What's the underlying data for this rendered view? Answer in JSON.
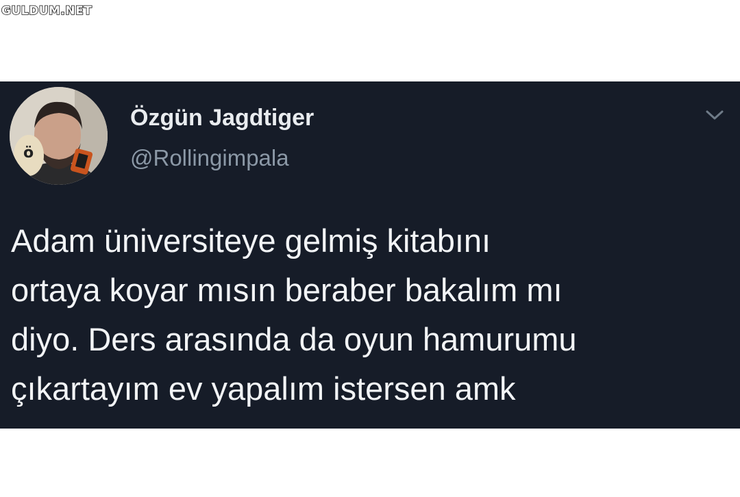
{
  "watermark": {
    "text": "GULDUM.NET"
  },
  "tweet": {
    "author": {
      "name": "Özgün Jagdtiger",
      "handle": "@Rollingimpala",
      "avatar_icon": "profile-photo"
    },
    "menu_icon": "chevron-down-icon",
    "text": "Adam üniversiteye gelmiş kitabını\nortaya koyar mısın beraber bakalım mı\ndiyo. Ders arasında da oyun hamurumu\nçıkartayım ev yapalım istersen amk"
  },
  "colors": {
    "tweet_background": "#161c28",
    "name_text": "#e9ecef",
    "handle_text": "#8b98a6",
    "body_text": "#f2f4f6",
    "page_background": "#ffffff"
  }
}
